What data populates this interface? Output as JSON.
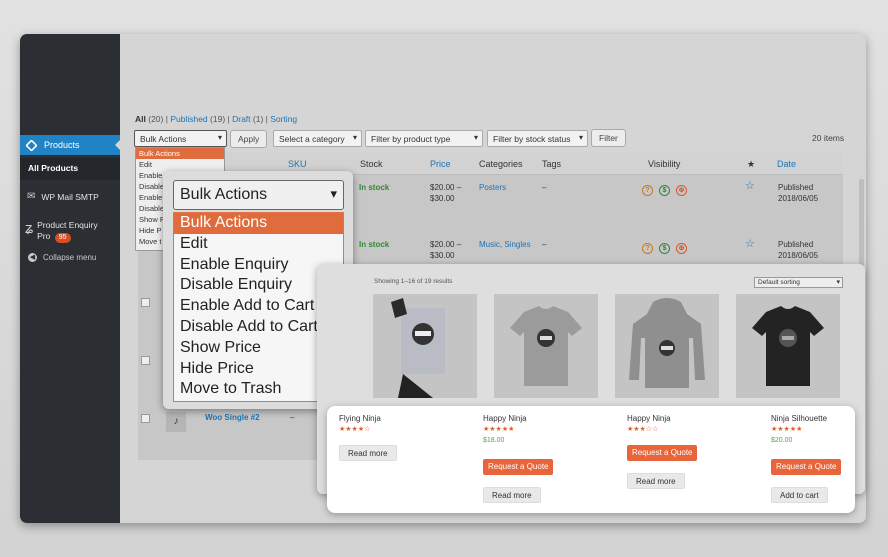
{
  "sidebar": {
    "products": "Products",
    "all_products": "All Products",
    "wp_mail": "WP Mail SMTP",
    "enquiry": "Product Enquiry",
    "enquiry2": "Pro",
    "enquiry_badge": "95",
    "collapse": "Collapse menu"
  },
  "filters": {
    "all": "All",
    "all_count": "(20)",
    "published": "Published",
    "published_count": "(19)",
    "draft": "Draft",
    "draft_count": "(1)",
    "sorting": "Sorting",
    "bulk": "Bulk Actions",
    "apply": "Apply",
    "category": "Select a category",
    "ptype": "Filter by product type",
    "stock": "Filter by stock status",
    "filter": "Filter",
    "count": "20 items"
  },
  "table": {
    "sku": "SKU",
    "stock": "Stock",
    "price": "Price",
    "categories": "Categories",
    "tags": "Tags",
    "visibility": "Visibility",
    "star": "★",
    "date": "Date",
    "rows": [
      {
        "stock": "In stock",
        "price1": "$20.00 –",
        "price2": "$30.00",
        "cat": "Posters",
        "tags": "–",
        "status": "Published",
        "date": "2018/06/05"
      },
      {
        "stock": "In stock",
        "price1": "$20.00 –",
        "price2": "$30.00",
        "cat": "Music, Singles",
        "tags": "–",
        "status": "Published",
        "date": "2018/06/05"
      }
    ],
    "woo_single": "Woo Single #2",
    "dash": "–"
  },
  "bulk_menu": {
    "title": "Bulk Actions",
    "items": [
      "Bulk Actions",
      "Edit",
      "Enable Enquiry",
      "Disable Enquiry",
      "Enable Add to Cart",
      "Disable Add to Cart",
      "Show Price",
      "Hide Price",
      "Move to Trash"
    ],
    "small_items": [
      "Bulk Actions",
      "Edit",
      "Enable",
      "Disable",
      "Enable",
      "Disable",
      "Show P",
      "Hide P",
      "Move t"
    ]
  },
  "shop": {
    "results": "Showing 1–16 of 19 results",
    "sorting": "Default sorting",
    "products": [
      {
        "name": "Flying Ninja",
        "stars": "★★★★☆",
        "price": "",
        "quote": "",
        "action": "Read more"
      },
      {
        "name": "Happy Ninja",
        "stars": "★★★★★",
        "price": "$18.00",
        "quote": "Request a Quote",
        "action": "Read more"
      },
      {
        "name": "Happy Ninja",
        "stars": "★★★☆☆",
        "price": "",
        "quote": "Request a Quote",
        "action": "Read more"
      },
      {
        "name": "Ninja Silhouette",
        "stars": "★★★★★",
        "price": "$20.00",
        "quote": "Request a Quote",
        "action": "Add to cart"
      }
    ]
  },
  "colors": {
    "accent": "#e8643a",
    "wp_blue": "#1f83c5",
    "sidebar": "#2b2f33",
    "link": "#1e74b3",
    "stock": "#2d8a35"
  },
  "icons": [
    "products-icon",
    "mail-icon",
    "enquiry-icon",
    "collapse-icon",
    "star-icon"
  ]
}
